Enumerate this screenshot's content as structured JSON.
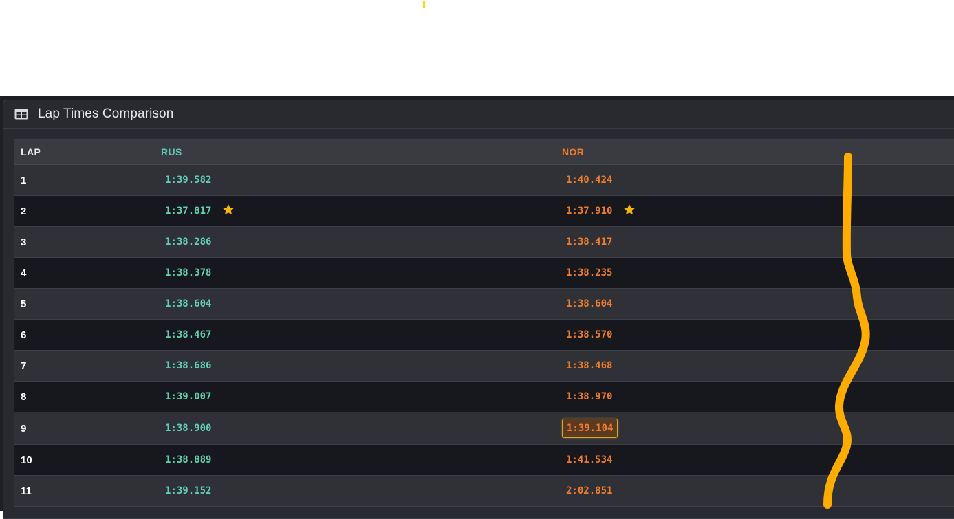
{
  "panel": {
    "title": "Lap Times Comparison",
    "icon": "table-icon"
  },
  "table": {
    "headers": {
      "lap": "LAP",
      "driver1": "RUS",
      "driver2": "NOR"
    },
    "rows": [
      {
        "lap": "1",
        "rus": "1:39.582",
        "nor": "1:40.424",
        "rus_best": false,
        "nor_best": false,
        "nor_highlight": false
      },
      {
        "lap": "2",
        "rus": "1:37.817",
        "nor": "1:37.910",
        "rus_best": true,
        "nor_best": true,
        "nor_highlight": false
      },
      {
        "lap": "3",
        "rus": "1:38.286",
        "nor": "1:38.417",
        "rus_best": false,
        "nor_best": false,
        "nor_highlight": false
      },
      {
        "lap": "4",
        "rus": "1:38.378",
        "nor": "1:38.235",
        "rus_best": false,
        "nor_best": false,
        "nor_highlight": false
      },
      {
        "lap": "5",
        "rus": "1:38.604",
        "nor": "1:38.604",
        "rus_best": false,
        "nor_best": false,
        "nor_highlight": false
      },
      {
        "lap": "6",
        "rus": "1:38.467",
        "nor": "1:38.570",
        "rus_best": false,
        "nor_best": false,
        "nor_highlight": false
      },
      {
        "lap": "7",
        "rus": "1:38.686",
        "nor": "1:38.468",
        "rus_best": false,
        "nor_best": false,
        "nor_highlight": false
      },
      {
        "lap": "8",
        "rus": "1:39.007",
        "nor": "1:38.970",
        "rus_best": false,
        "nor_best": false,
        "nor_highlight": false
      },
      {
        "lap": "9",
        "rus": "1:38.900",
        "nor": "1:39.104",
        "rus_best": false,
        "nor_best": false,
        "nor_highlight": true
      },
      {
        "lap": "10",
        "rus": "1:38.889",
        "nor": "1:41.534",
        "rus_best": false,
        "nor_best": false,
        "nor_highlight": false
      },
      {
        "lap": "11",
        "rus": "1:39.152",
        "nor": "2:02.851",
        "rus_best": false,
        "nor_best": false,
        "nor_highlight": false
      }
    ]
  },
  "colors": {
    "rus": "#5fd0b4",
    "nor": "#f07c2a",
    "star": "#f5b50a",
    "annotation": "#ffac00"
  }
}
